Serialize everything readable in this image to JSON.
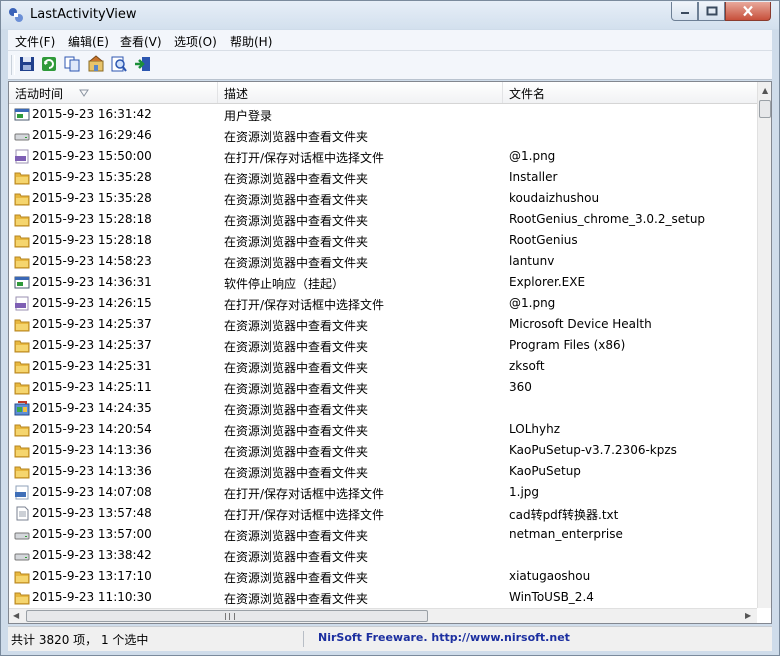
{
  "window": {
    "title": "LastActivityView"
  },
  "menu": [
    "文件(F)",
    "编辑(E)",
    "查看(V)",
    "选项(O)",
    "帮助(H)"
  ],
  "toolbar": {
    "buttons": [
      "save-icon",
      "refresh-icon",
      "copy-icon",
      "properties-icon",
      "find-icon",
      "exit-icon"
    ]
  },
  "columns": {
    "time": "活动时间",
    "desc": "描述",
    "file": "文件名"
  },
  "rows": [
    {
      "time": "2015-9-23 16:31:42",
      "desc": "用户登录",
      "file": "",
      "icon": "window"
    },
    {
      "time": "2015-9-23 16:29:46",
      "desc": "在资源浏览器中查看文件夹",
      "file": "",
      "icon": "drive"
    },
    {
      "time": "2015-9-23 15:50:00",
      "desc": "在打开/保存对话框中选择文件",
      "file": "@1.png",
      "icon": "png"
    },
    {
      "time": "2015-9-23 15:35:28",
      "desc": "在资源浏览器中查看文件夹",
      "file": "Installer",
      "icon": "folder"
    },
    {
      "time": "2015-9-23 15:35:28",
      "desc": "在资源浏览器中查看文件夹",
      "file": "koudaizhushou",
      "icon": "folder"
    },
    {
      "time": "2015-9-23 15:28:18",
      "desc": "在资源浏览器中查看文件夹",
      "file": "RootGenius_chrome_3.0.2_setup",
      "icon": "folder"
    },
    {
      "time": "2015-9-23 15:28:18",
      "desc": "在资源浏览器中查看文件夹",
      "file": "RootGenius",
      "icon": "folder"
    },
    {
      "time": "2015-9-23 14:58:23",
      "desc": "在资源浏览器中查看文件夹",
      "file": "lantunv",
      "icon": "folder"
    },
    {
      "time": "2015-9-23 14:36:31",
      "desc": "软件停止响应（挂起）",
      "file": "Explorer.EXE",
      "icon": "window"
    },
    {
      "time": "2015-9-23 14:26:15",
      "desc": "在打开/保存对话框中选择文件",
      "file": "@1.png",
      "icon": "png"
    },
    {
      "time": "2015-9-23 14:25:37",
      "desc": "在资源浏览器中查看文件夹",
      "file": "Microsoft Device Health",
      "icon": "folder"
    },
    {
      "time": "2015-9-23 14:25:37",
      "desc": "在资源浏览器中查看文件夹",
      "file": "Program Files (x86)",
      "icon": "folder"
    },
    {
      "time": "2015-9-23 14:25:31",
      "desc": "在资源浏览器中查看文件夹",
      "file": "zksoft",
      "icon": "folder"
    },
    {
      "time": "2015-9-23 14:25:11",
      "desc": "在资源浏览器中查看文件夹",
      "file": "360",
      "icon": "folder"
    },
    {
      "time": "2015-9-23 14:24:35",
      "desc": "在资源浏览器中查看文件夹",
      "file": "",
      "icon": "control"
    },
    {
      "time": "2015-9-23 14:20:54",
      "desc": "在资源浏览器中查看文件夹",
      "file": "LOLhyhz",
      "icon": "folder"
    },
    {
      "time": "2015-9-23 14:13:36",
      "desc": "在资源浏览器中查看文件夹",
      "file": "KaoPuSetup-v3.7.2306-kpzs",
      "icon": "folder"
    },
    {
      "time": "2015-9-23 14:13:36",
      "desc": "在资源浏览器中查看文件夹",
      "file": "KaoPuSetup",
      "icon": "folder"
    },
    {
      "time": "2015-9-23 14:07:08",
      "desc": "在打开/保存对话框中选择文件",
      "file": "1.jpg",
      "icon": "jpg"
    },
    {
      "time": "2015-9-23 13:57:48",
      "desc": "在打开/保存对话框中选择文件",
      "file": "cad转pdf转换器.txt",
      "icon": "txt"
    },
    {
      "time": "2015-9-23 13:57:00",
      "desc": "在资源浏览器中查看文件夹",
      "file": "netman_enterprise",
      "icon": "drive"
    },
    {
      "time": "2015-9-23 13:38:42",
      "desc": "在资源浏览器中查看文件夹",
      "file": "",
      "icon": "drive"
    },
    {
      "time": "2015-9-23 13:17:10",
      "desc": "在资源浏览器中查看文件夹",
      "file": "xiatugaoshou",
      "icon": "folder"
    },
    {
      "time": "2015-9-23 11:10:30",
      "desc": "在资源浏览器中查看文件夹",
      "file": "WinToUSB_2.4",
      "icon": "folder"
    }
  ],
  "status": {
    "count": "共计 3820 项， 1 个选中",
    "link": "NirSoft Freeware.  http://www.nirsoft.net"
  }
}
